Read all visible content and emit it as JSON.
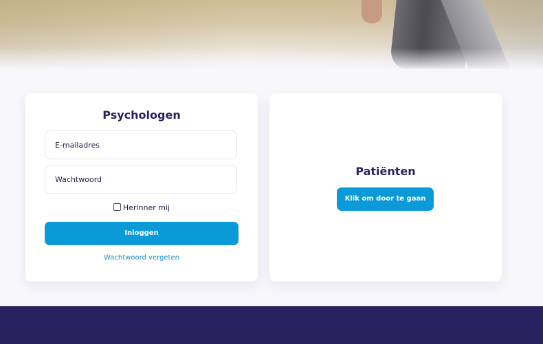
{
  "psychologists": {
    "title": "Psychologen",
    "email_placeholder": "E-mailadres",
    "password_placeholder": "Wachtwoord",
    "remember_label": "Herinner mij",
    "login_label": "Inloggen",
    "forgot_label": "Wachtwoord vergeten"
  },
  "patients": {
    "title": "Patiënten",
    "continue_label": "Klik om door te gaan"
  },
  "colors": {
    "primary_button": "#0b9ad8",
    "heading": "#2a2260",
    "footer": "#2a2160",
    "link": "#1c8fc4"
  }
}
